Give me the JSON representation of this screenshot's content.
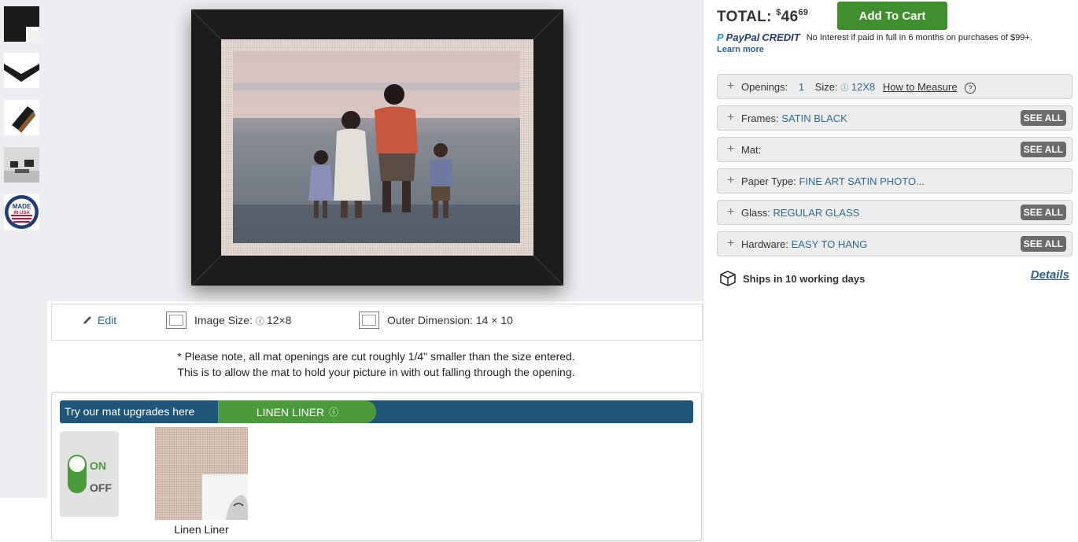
{
  "thumbnails": [
    {
      "name": "frame-corner-thumbnail"
    },
    {
      "name": "frame-profile-thumbnail"
    },
    {
      "name": "frame-side-thumbnail"
    },
    {
      "name": "room-view-thumbnail"
    },
    {
      "name": "made-in-usa-thumbnail",
      "text_line1": "MADE",
      "text_line2": "IN USA"
    }
  ],
  "info_bar": {
    "edit_label": "Edit",
    "image_size_label": "Image Size: ",
    "image_size_value": "12×8",
    "outer_dimension_label": "Outer Dimension: 14 × 10"
  },
  "note": {
    "line1": "* Please note, all mat openings are cut roughly 1/4\" smaller than the size entered.",
    "line2": "This is to allow the mat to hold your picture in with out falling through the opening."
  },
  "upgrades": {
    "label": "Try our mat upgrades here",
    "tab_label": "LINEN LINER",
    "toggle_on": "ON",
    "toggle_off": "OFF",
    "toggle_state": "on",
    "swatch_label": "Linen Liner"
  },
  "purchase": {
    "total_label": "TOTAL: ",
    "currency": "$",
    "dollars": "46",
    "cents": "69",
    "add_to_cart": "Add To Cart",
    "paypal_brand": "PayPal",
    "paypal_credit": "CREDIT",
    "paypal_text": "No Interest if paid in full in 6 months on purchases of $99+.",
    "learn_more": "Learn more"
  },
  "options": {
    "openings_label": "Openings:",
    "openings_count": "1",
    "size_label": "Size:",
    "size_value": "12X8",
    "how_to_measure": "How to Measure",
    "frames_label": "Frames: ",
    "frames_value": "SATIN BLACK",
    "mat_label": "Mat:",
    "paper_label": "Paper Type: ",
    "paper_value": "FINE ART SATIN PHOTO...",
    "glass_label": "Glass: ",
    "glass_value": "REGULAR GLASS",
    "hardware_label": "Hardware: ",
    "hardware_value": "EASY TO HANG",
    "see_all": "SEE ALL"
  },
  "shipping": {
    "text": "Ships in 10 working days",
    "details": "Details"
  },
  "colors": {
    "accent_green": "#3f8f2e",
    "tab_blue": "#1f5579",
    "link_blue": "#2a6496",
    "frame_black": "#1c1c1c"
  }
}
